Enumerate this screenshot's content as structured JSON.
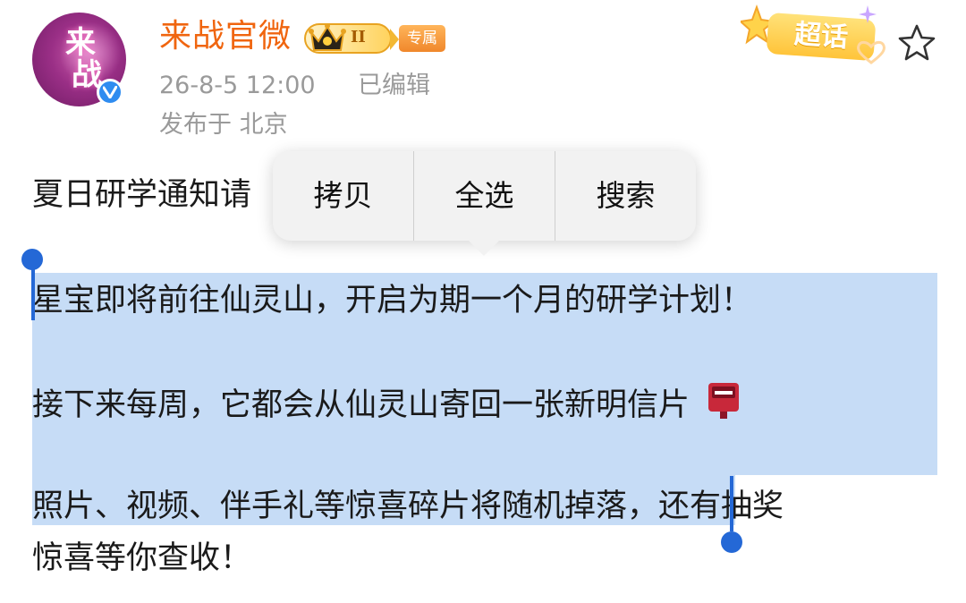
{
  "post": {
    "author": {
      "username": "来战官微",
      "avatar_text": [
        "来",
        "战"
      ],
      "verified": true,
      "rank_level": "II",
      "exclusive_badge": "专属"
    },
    "timestamp": "26-8-5 12:00",
    "edited_label": "已编辑",
    "location": "发布于 北京",
    "supertopic_label": "超话",
    "favorite_icon": "star-outline-icon",
    "body": {
      "line1_visible": "夏日研学通知请",
      "line2": "星宝即将前往仙灵山，开启为期一个月的研学计划！",
      "line3": "接下来每周，它都会从仙灵山寄回一张新明信片",
      "line3_emoji": "postbox-icon",
      "line4_selected": "照片、视频、伴手礼等惊喜碎片将随机掉落",
      "line4_rest": "，还有抽奖",
      "line5": "惊喜等你查收！"
    }
  },
  "context_menu": {
    "items": [
      "拷贝",
      "全选",
      "搜索"
    ]
  },
  "colors": {
    "username": "#f0650f",
    "selection": "#c6dcf6",
    "caret": "#2468d6",
    "meta_text": "#9a9a9a",
    "verified_badge": "#2f8cf0"
  }
}
